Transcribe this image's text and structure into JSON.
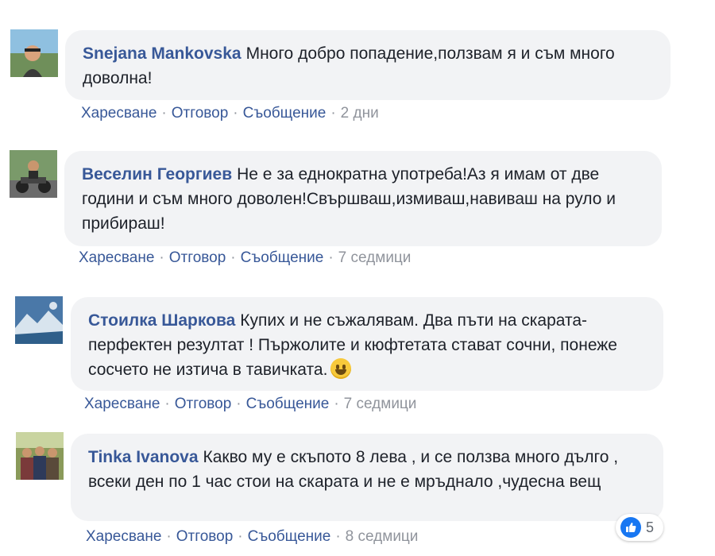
{
  "comments": [
    {
      "author": "Snejana Mankovska",
      "text": "Много добро попадение,ползвам я и съм много доволна!",
      "actions": {
        "like": "Харесване",
        "reply": "Отговор",
        "message": "Съобщение",
        "time": "2 дни"
      }
    },
    {
      "author": "Веселин Георгиев",
      "text": "Не е за еднократна употреба!Аз я имам от две години и съм много доволен!Свършваш,измиваш,навиваш на руло и прибираш!",
      "actions": {
        "like": "Харесване",
        "reply": "Отговор",
        "message": "Съобщение",
        "time": "7 седмици"
      }
    },
    {
      "author": "Стоилка Шаркова",
      "text": "Купих и не съжалявам. Два пъти на скарата- перфектен резултат ! Пържолите и кюфтетата стават сочни, понеже сосчето не изтича в тавичката.",
      "actions": {
        "like": "Харесване",
        "reply": "Отговор",
        "message": "Съобщение",
        "time": "7 седмици"
      }
    },
    {
      "author": "Tinka Ivanova",
      "text": "Какво му е скъпото 8 лева , и се ползва много дълго , всеки ден по 1 час стои на скарата и не е мръднало ,чудесна вещ",
      "actions": {
        "like": "Харесване",
        "reply": "Отговор",
        "message": "Съобщение",
        "time": "8 седмици"
      }
    }
  ],
  "reactions": {
    "count": "5",
    "icon": "thumbs-up-icon",
    "color": "#1877f2"
  }
}
